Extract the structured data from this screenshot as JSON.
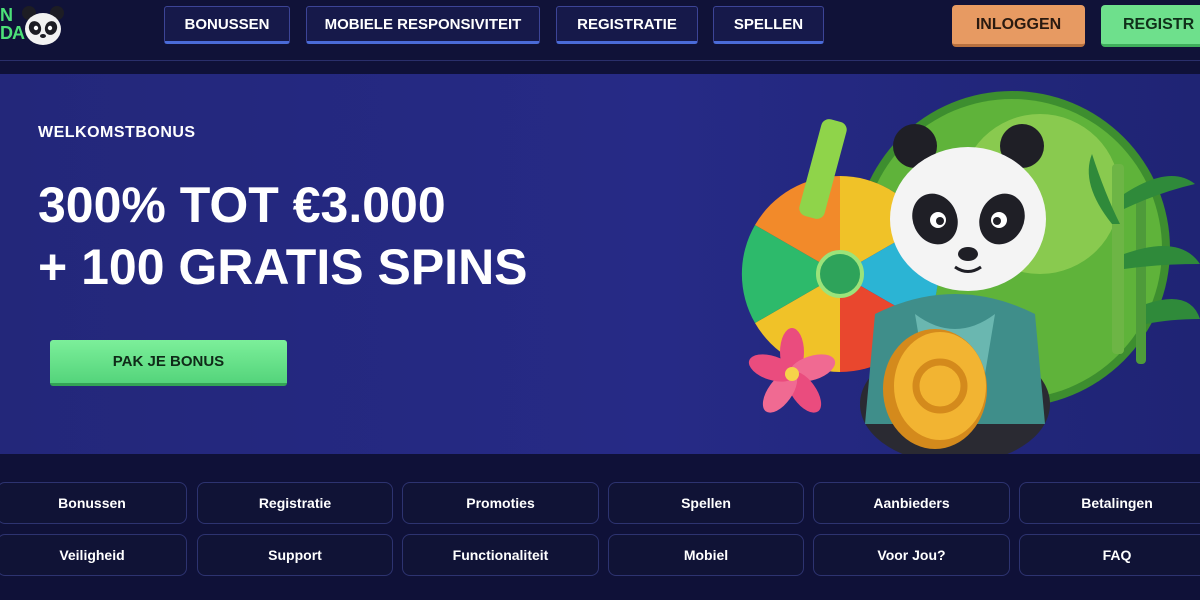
{
  "header": {
    "logo_line1": "N",
    "logo_line2": "DA",
    "nav": [
      "BONUSSEN",
      "MOBIELE RESPONSIVITEIT",
      "REGISTRATIE",
      "SPELLEN"
    ],
    "login_label": "INLOGGEN",
    "register_label": "REGISTR"
  },
  "hero": {
    "label": "WELKOMSTBONUS",
    "title_line1": "300% TOT €3.000",
    "title_line2": "+ 100 GRATIS SPINS",
    "cta_label": "PAK JE BONUS"
  },
  "links": {
    "row1": [
      "Bonussen",
      "Registratie",
      "Promoties",
      "Spellen",
      "Aanbieders",
      "Betalingen"
    ],
    "row2": [
      "Veiligheid",
      "Support",
      "Functionaliteit",
      "Mobiel",
      "Voor Jou?",
      "FAQ"
    ]
  },
  "colors": {
    "background": "#0f1138",
    "hero_background": "#262a86",
    "accent_green": "#6ee08c",
    "accent_orange": "#e79a62"
  },
  "icons": [
    "panda-logo-icon",
    "panda-hero-illustration",
    "prize-wheel-icon",
    "bamboo-icon",
    "flower-icon",
    "coin-icon"
  ]
}
